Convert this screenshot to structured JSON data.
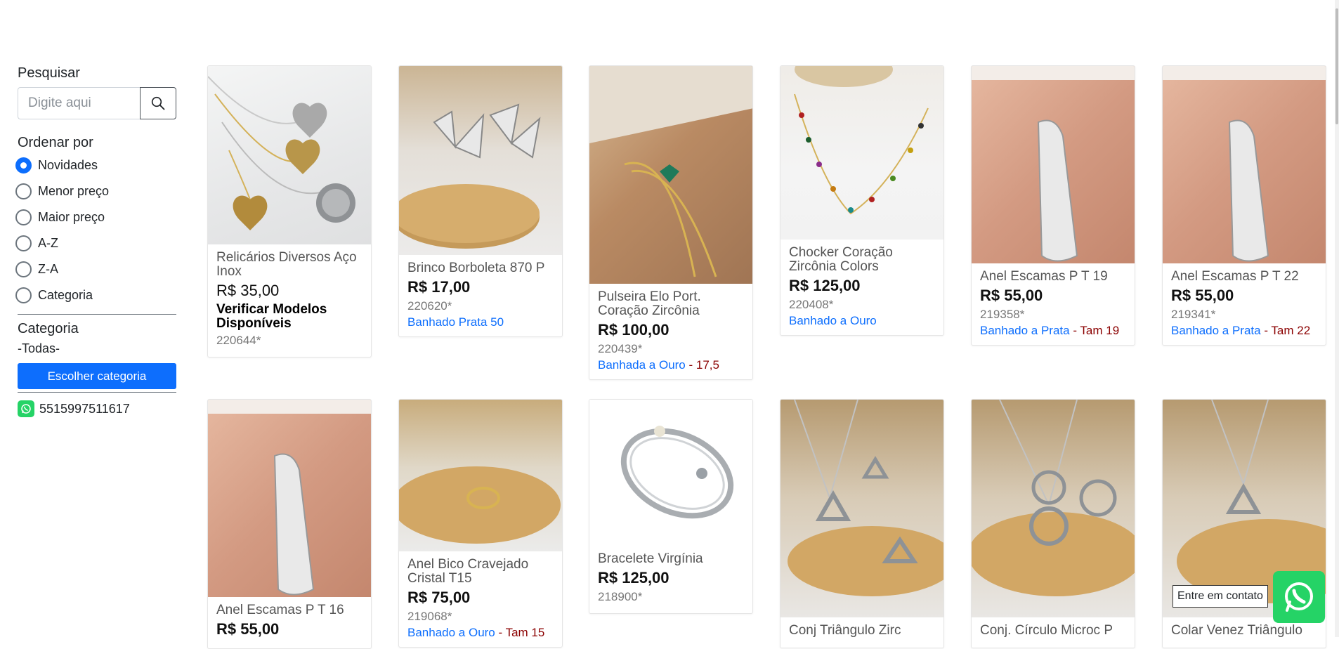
{
  "sidebar": {
    "search": {
      "title": "Pesquisar",
      "placeholder": "Digite aqui"
    },
    "sort": {
      "title": "Ordenar por",
      "options": [
        "Novidades",
        "Menor preço",
        "Maior preço",
        "A-Z",
        "Z-A",
        "Categoria"
      ],
      "selected": "Novidades"
    },
    "category": {
      "title": "Categoria",
      "current": "-Todas-",
      "button": "Escolher categoria"
    },
    "phone": "5515997511617"
  },
  "products": [
    {
      "name": "Relicários Diversos Aço Inox",
      "price": "R$ 35,00",
      "note": "Verificar Modelos Disponíveis",
      "code": "220644*",
      "variant": "",
      "size": ""
    },
    {
      "name": "Brinco Borboleta 870 P",
      "price": "R$ 17,00",
      "note": "",
      "code": "220620*",
      "variant": "Banhado Prata 50",
      "size": ""
    },
    {
      "name": "Pulseira Elo Port. Coração Zircônia",
      "price": "R$ 100,00",
      "note": "",
      "code": "220439*",
      "variant": "Banhada a Ouro",
      "size": " - 17,5"
    },
    {
      "name": "Chocker Coração Zircônia Colors",
      "price": "R$ 125,00",
      "note": "",
      "code": "220408*",
      "variant": "Banhado a Ouro",
      "size": ""
    },
    {
      "name": "Anel Escamas P T 19",
      "price": "R$ 55,00",
      "note": "",
      "code": "219358*",
      "variant": "Banhado a Prata",
      "size": " - Tam 19"
    },
    {
      "name": "Anel Escamas P T 22",
      "price": "R$ 55,00",
      "note": "",
      "code": "219341*",
      "variant": "Banhado a Prata",
      "size": " - Tam 22"
    },
    {
      "name": "Anel Escamas P T 16",
      "price": "R$ 55,00",
      "note": "",
      "code": "",
      "variant": "",
      "size": ""
    },
    {
      "name": "Anel Bico Cravejado Cristal T15",
      "price": "R$ 75,00",
      "note": "",
      "code": "219068*",
      "variant": "Banhado a Ouro",
      "size": " - Tam 15"
    },
    {
      "name": "Bracelete Virgínia",
      "price": "R$ 125,00",
      "note": "",
      "code": "218900*",
      "variant": "",
      "size": ""
    },
    {
      "name": "Conj Triângulo Zirc",
      "price": "",
      "note": "",
      "code": "",
      "variant": "",
      "size": ""
    },
    {
      "name": "Conj. Círculo Microc P",
      "price": "",
      "note": "",
      "code": "",
      "variant": "",
      "size": ""
    },
    {
      "name": "Colar Venez Triângulo",
      "price": "",
      "note": "",
      "code": "",
      "variant": "",
      "size": ""
    }
  ],
  "contact": {
    "label": "Entre em contato"
  },
  "colors": {
    "accent": "#0d6efd",
    "whatsapp": "#25d366",
    "size_text": "#8b0000"
  }
}
